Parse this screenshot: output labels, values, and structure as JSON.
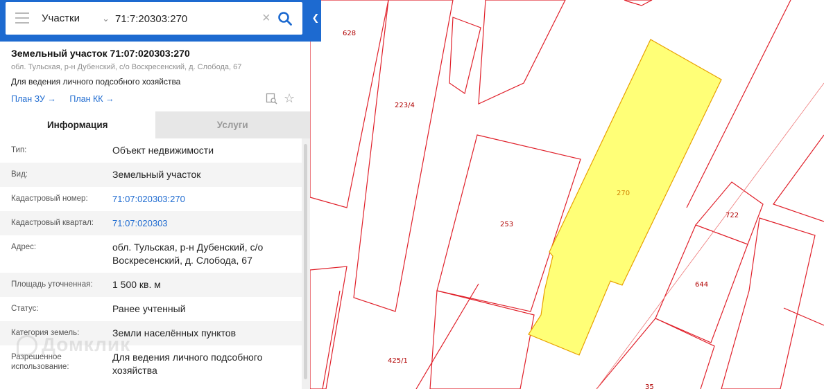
{
  "search": {
    "layer": "Участки",
    "query": "71:7:20303:270"
  },
  "card": {
    "title": "Земельный участок 71:07:020303:270",
    "address": "обл. Тульская, р-н Дубенский, с/о Воскресенский, д. Слобода, 67",
    "purpose": "Для ведения личного подсобного хозяйства",
    "links": [
      {
        "label": "План ЗУ →"
      },
      {
        "label": "План КК →"
      }
    ]
  },
  "tabs": [
    {
      "label": "Информация",
      "active": true
    },
    {
      "label": "Услуги",
      "active": false
    }
  ],
  "info": [
    {
      "label": "Тип:",
      "value": "Объект недвижимости"
    },
    {
      "label": "Вид:",
      "value": "Земельный участок"
    },
    {
      "label": "Кадастровый номер:",
      "value": "71:07:020303:270"
    },
    {
      "label": "Кадастровый квартал:",
      "value": "71:07:020303"
    },
    {
      "label": "Адрес:",
      "value": "обл. Тульская, р-н Дубенский, с/о Воскресенский, д. Слобода, 67"
    },
    {
      "label": "Площадь уточненная:",
      "value": "1 500 кв. м"
    },
    {
      "label": "Статус:",
      "value": "Ранее учтенный"
    },
    {
      "label": "Категория земель:",
      "value": "Земли населённых пунктов"
    },
    {
      "label": "Разрешенное использование:",
      "value": "Для ведения личного подсобного хозяйства"
    }
  ],
  "map": {
    "parcel_labels": [
      "628",
      "223/4",
      "253",
      "270",
      "722",
      "644",
      "425/1",
      "35"
    ],
    "selected_parcel": "270",
    "colors": {
      "boundary": "#e0202a",
      "selected_fill": "#ffff77",
      "selected_stroke": "#e8a000",
      "label": "#b00000"
    }
  },
  "watermark": "Домклик",
  "colors": {
    "accent": "#1d6ad0"
  }
}
